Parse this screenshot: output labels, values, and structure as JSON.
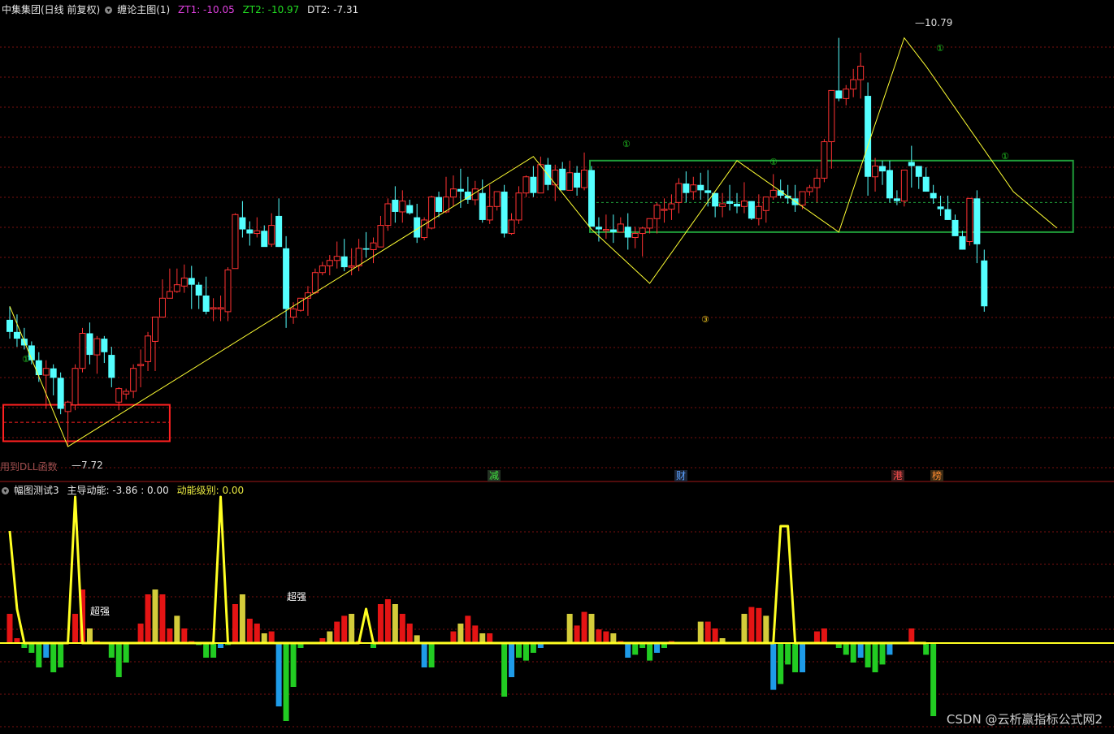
{
  "header": {
    "symbol_label": "中集集团(日线 前复权)",
    "indicator_name": "缠论主图(1)",
    "zt1_label": "ZT1: -10.05",
    "zt2_label": "ZT2: -10.97",
    "dt2_label": "DT2: -7.31"
  },
  "lower_header": {
    "indicator_name": "幅图测试3",
    "main_label": "主导动能: -3.86 : 0.00",
    "level_label": "动能级别: 0.00"
  },
  "annotations": {
    "low_price": "7.72",
    "high_price": "10.79",
    "dll_text": "用到DLL函数",
    "tag_jian": "减",
    "tag_cai": "财",
    "tag_gang": "港",
    "tag_bang": "榜",
    "super_strong_1": "超强",
    "super_strong_2": "超强",
    "pivot_1": "①",
    "pivot_2": "①",
    "pivot_3": "①",
    "pivot_4": "①",
    "pivot_5": "①",
    "pivot_6": "③"
  },
  "watermark": "CSDN @云析赢指标公式网2",
  "colors": {
    "up": "#ff3232",
    "down": "#54ffff",
    "zigzag": "#ffff33",
    "box": "#1f9e3a",
    "grid": "#7a1010",
    "bar_red": "#e41414",
    "bar_yellow": "#d4cc3a",
    "bar_green": "#22cc22",
    "bar_blue": "#1e9be8",
    "line_yellow": "#ffff22"
  },
  "chart_data": [
    {
      "type": "candlestick",
      "y_range": [
        7.6,
        10.85
      ],
      "candles": [
        [
          8.66,
          8.76,
          8.52,
          8.57
        ],
        [
          8.57,
          8.7,
          8.46,
          8.52
        ],
        [
          8.52,
          8.6,
          8.44,
          8.47
        ],
        [
          8.47,
          8.5,
          8.33,
          8.36
        ],
        [
          8.36,
          8.42,
          8.2,
          8.25
        ],
        [
          8.25,
          8.36,
          8.0,
          8.3
        ],
        [
          8.3,
          8.33,
          8.1,
          8.23
        ],
        [
          8.23,
          8.27,
          7.96,
          8.0
        ],
        [
          7.98,
          8.06,
          7.72,
          8.05
        ],
        [
          8.03,
          8.33,
          7.99,
          8.3
        ],
        [
          8.3,
          8.6,
          8.27,
          8.56
        ],
        [
          8.56,
          8.64,
          8.33,
          8.4
        ],
        [
          8.4,
          8.54,
          8.26,
          8.52
        ],
        [
          8.52,
          8.54,
          8.34,
          8.42
        ],
        [
          8.4,
          8.46,
          8.16,
          8.23
        ],
        [
          8.05,
          8.16,
          7.99,
          8.15
        ],
        [
          8.11,
          8.15,
          8.07,
          8.13
        ],
        [
          8.13,
          8.33,
          8.08,
          8.3
        ],
        [
          8.32,
          8.44,
          8.16,
          8.33
        ],
        [
          8.35,
          8.57,
          8.28,
          8.54
        ],
        [
          8.5,
          8.66,
          8.28,
          8.68
        ],
        [
          8.68,
          8.96,
          8.72,
          8.82
        ],
        [
          8.82,
          9.04,
          8.84,
          8.87
        ],
        [
          8.87,
          9.04,
          8.86,
          8.92
        ],
        [
          8.91,
          9.07,
          8.86,
          8.97
        ],
        [
          8.97,
          9.06,
          8.74,
          8.92
        ],
        [
          8.92,
          8.94,
          8.74,
          8.84
        ],
        [
          8.84,
          8.98,
          8.7,
          8.72
        ],
        [
          8.74,
          8.82,
          8.65,
          8.75
        ],
        [
          8.74,
          8.84,
          8.65,
          8.75
        ],
        [
          8.72,
          9.05,
          8.65,
          9.03
        ],
        [
          9.04,
          9.45,
          9.18,
          9.44
        ],
        [
          9.42,
          9.54,
          9.27,
          9.33
        ],
        [
          9.33,
          9.39,
          9.21,
          9.3
        ],
        [
          9.3,
          9.42,
          9.27,
          9.32
        ],
        [
          9.32,
          9.36,
          9.22,
          9.2
        ],
        [
          9.22,
          9.45,
          9.2,
          9.36
        ],
        [
          9.43,
          9.56,
          9.2,
          9.2
        ],
        [
          9.19,
          9.28,
          8.6,
          8.74
        ],
        [
          8.68,
          8.79,
          8.63,
          8.74
        ],
        [
          8.73,
          8.82,
          8.72,
          8.82
        ],
        [
          8.82,
          8.91,
          8.69,
          8.86
        ],
        [
          8.86,
          9.04,
          8.85,
          9.01
        ],
        [
          9.01,
          9.09,
          8.99,
          9.06
        ],
        [
          9.06,
          9.14,
          8.99,
          9.1
        ],
        [
          9.1,
          9.24,
          9.04,
          9.13
        ],
        [
          9.13,
          9.26,
          9.02,
          9.05
        ],
        [
          9.05,
          9.19,
          8.99,
          9.06
        ],
        [
          9.06,
          9.26,
          9.02,
          9.19
        ],
        [
          9.19,
          9.31,
          9.12,
          9.18
        ],
        [
          9.18,
          9.27,
          9.08,
          9.23
        ],
        [
          9.2,
          9.43,
          9.2,
          9.36
        ],
        [
          9.36,
          9.56,
          9.32,
          9.52
        ],
        [
          9.55,
          9.65,
          9.38,
          9.46
        ],
        [
          9.46,
          9.62,
          9.38,
          9.54
        ],
        [
          9.51,
          9.55,
          9.44,
          9.45
        ],
        [
          9.42,
          9.52,
          9.23,
          9.27
        ],
        [
          9.27,
          9.42,
          9.25,
          9.4
        ],
        [
          9.34,
          9.58,
          9.33,
          9.57
        ],
        [
          9.57,
          9.61,
          9.42,
          9.46
        ],
        [
          9.46,
          9.72,
          9.45,
          9.57
        ],
        [
          9.57,
          9.73,
          9.5,
          9.63
        ],
        [
          9.63,
          9.78,
          9.49,
          9.61
        ],
        [
          9.61,
          9.72,
          9.52,
          9.55
        ],
        [
          9.55,
          9.69,
          9.51,
          9.63
        ],
        [
          9.6,
          9.7,
          9.38,
          9.4
        ],
        [
          9.4,
          9.66,
          9.37,
          9.5
        ],
        [
          9.5,
          9.61,
          9.47,
          9.61
        ],
        [
          9.61,
          9.66,
          9.27,
          9.3
        ],
        [
          9.3,
          9.45,
          9.29,
          9.4
        ],
        [
          9.4,
          9.65,
          9.37,
          9.6
        ],
        [
          9.6,
          9.73,
          9.57,
          9.72
        ],
        [
          9.72,
          9.8,
          9.57,
          9.6
        ],
        [
          9.6,
          9.87,
          9.62,
          9.81
        ],
        [
          9.81,
          9.86,
          9.62,
          9.66
        ],
        [
          9.66,
          9.81,
          9.54,
          9.77
        ],
        [
          9.78,
          9.83,
          9.65,
          9.62
        ],
        [
          9.62,
          9.84,
          9.65,
          9.75
        ],
        [
          9.75,
          9.8,
          9.58,
          9.64
        ],
        [
          9.64,
          9.9,
          9.62,
          9.77
        ],
        [
          9.77,
          9.8,
          9.39,
          9.35
        ],
        [
          9.35,
          9.42,
          9.24,
          9.33
        ],
        [
          9.33,
          9.44,
          9.26,
          9.33
        ],
        [
          9.33,
          9.44,
          9.23,
          9.31
        ],
        [
          9.31,
          9.42,
          9.31,
          9.37
        ],
        [
          9.35,
          9.45,
          9.18,
          9.27
        ],
        [
          9.27,
          9.35,
          9.19,
          9.3
        ],
        [
          9.3,
          9.35,
          9.13,
          9.34
        ],
        [
          9.34,
          9.41,
          9.3,
          9.41
        ],
        [
          9.41,
          9.53,
          9.3,
          9.51
        ],
        [
          9.48,
          9.56,
          9.38,
          9.48
        ],
        [
          9.48,
          9.59,
          9.4,
          9.52
        ],
        [
          9.53,
          9.71,
          9.45,
          9.67
        ],
        [
          9.67,
          9.76,
          9.53,
          9.6
        ],
        [
          9.61,
          9.72,
          9.55,
          9.66
        ],
        [
          9.66,
          9.75,
          9.55,
          9.62
        ],
        [
          9.62,
          9.77,
          9.5,
          9.6
        ],
        [
          9.6,
          9.6,
          9.42,
          9.5
        ],
        [
          9.5,
          9.6,
          9.42,
          9.52
        ],
        [
          9.54,
          9.66,
          9.47,
          9.52
        ],
        [
          9.52,
          9.6,
          9.45,
          9.5
        ],
        [
          9.5,
          9.68,
          9.45,
          9.54
        ],
        [
          9.54,
          9.54,
          9.4,
          9.41
        ],
        [
          9.41,
          9.59,
          9.36,
          9.5
        ],
        [
          9.47,
          9.55,
          9.38,
          9.57
        ],
        [
          9.57,
          9.74,
          9.55,
          9.62
        ],
        [
          9.62,
          9.7,
          9.56,
          9.58
        ],
        [
          9.58,
          9.66,
          9.52,
          9.56
        ],
        [
          9.56,
          9.66,
          9.46,
          9.51
        ],
        [
          9.51,
          9.56,
          9.48,
          9.61
        ],
        [
          9.61,
          9.66,
          9.58,
          9.64
        ],
        [
          9.64,
          9.78,
          9.53,
          9.71
        ],
        [
          9.71,
          10.0,
          9.68,
          9.98
        ],
        [
          9.98,
          10.35,
          9.78,
          10.36
        ],
        [
          10.36,
          10.75,
          10.28,
          10.3
        ],
        [
          10.3,
          10.4,
          10.25,
          10.37
        ],
        [
          10.37,
          10.52,
          10.31,
          10.44
        ],
        [
          10.44,
          10.64,
          10.3,
          10.54
        ],
        [
          10.32,
          10.42,
          9.58,
          9.72
        ],
        [
          9.72,
          9.86,
          9.61,
          9.8
        ],
        [
          9.8,
          9.84,
          9.66,
          9.76
        ],
        [
          9.77,
          9.84,
          9.53,
          9.56
        ],
        [
          9.56,
          9.62,
          9.51,
          9.54
        ],
        [
          9.54,
          9.76,
          9.5,
          9.77
        ],
        [
          9.83,
          9.95,
          9.64,
          9.8
        ],
        [
          9.8,
          9.8,
          9.63,
          9.72
        ],
        [
          9.72,
          9.79,
          9.61,
          9.61
        ],
        [
          9.6,
          9.66,
          9.52,
          9.56
        ],
        [
          9.5,
          9.58,
          9.43,
          9.48
        ],
        [
          9.48,
          9.58,
          9.4,
          9.4
        ],
        [
          9.4,
          9.44,
          9.28,
          9.28
        ],
        [
          9.28,
          9.32,
          9.18,
          9.18
        ],
        [
          9.24,
          9.48,
          9.21,
          9.56
        ],
        [
          9.56,
          9.62,
          9.08,
          9.22
        ],
        [
          9.1,
          9.18,
          8.72,
          8.76
        ]
      ],
      "zigzag": [
        [
          0,
          8.76
        ],
        [
          8,
          7.72
        ],
        [
          72,
          9.87
        ],
        [
          80,
          9.33
        ],
        [
          88,
          8.93
        ],
        [
          100,
          9.84
        ],
        [
          114,
          9.31
        ],
        [
          123,
          10.75
        ],
        [
          126,
          10.54
        ],
        [
          138,
          9.61
        ],
        [
          144,
          9.34
        ]
      ],
      "center_box": {
        "from": 80,
        "to": 146,
        "top": 9.84,
        "bottom": 9.31
      },
      "center_mid": 9.53,
      "left_box": {
        "from": 0,
        "to": 22,
        "top": 8.03,
        "bottom": 7.76,
        "mid": 7.9
      }
    },
    {
      "type": "bar",
      "y_range": [
        -0.9,
        1.5
      ],
      "values": [
        0.3,
        0.05,
        -0.05,
        -0.1,
        -0.25,
        -0.15,
        -0.3,
        -0.25,
        0.0,
        0.3,
        0.55,
        0.15,
        0.02,
        0.0,
        -0.15,
        -0.35,
        -0.2,
        0.0,
        0.2,
        0.5,
        0.55,
        0.5,
        0.15,
        0.28,
        0.15,
        0.02,
        -0.02,
        -0.15,
        -0.15,
        -0.05,
        -0.02,
        0.4,
        0.5,
        0.25,
        0.2,
        0.1,
        0.12,
        -0.65,
        -0.8,
        -0.45,
        -0.05,
        0.0,
        0.0,
        0.05,
        0.12,
        0.22,
        0.28,
        0.3,
        0.02,
        0.0,
        -0.05,
        0.4,
        0.45,
        0.4,
        0.3,
        0.2,
        0.08,
        -0.25,
        -0.25,
        0.0,
        0.0,
        0.12,
        0.2,
        0.28,
        0.18,
        0.1,
        0.1,
        0.0,
        -0.55,
        -0.35,
        -0.15,
        -0.18,
        -0.1,
        -0.05,
        0.0,
        0.0,
        0.0,
        0.3,
        0.18,
        0.32,
        0.3,
        0.14,
        0.12,
        0.1,
        0.02,
        -0.15,
        -0.12,
        -0.05,
        -0.18,
        -0.1,
        -0.05,
        0.02,
        0.0,
        0.0,
        0.0,
        0.22,
        0.22,
        0.15,
        0.05,
        0.0,
        0.0,
        0.3,
        0.37,
        0.36,
        0.28,
        -0.48,
        -0.42,
        -0.22,
        -0.3,
        -0.3,
        0.0,
        0.12,
        0.15,
        0.0,
        -0.05,
        -0.12,
        -0.2,
        -0.15,
        -0.25,
        -0.3,
        -0.22,
        -0.12,
        0.0,
        0.0,
        0.15,
        0.0,
        -0.12,
        -0.75
      ],
      "line": [
        1.15,
        0.35,
        0.0,
        0.0,
        0.0,
        0.0,
        0.0,
        0.0,
        0.0,
        1.5,
        0.0,
        0.0,
        0.0,
        0.0,
        0.0,
        0.0,
        0.0,
        0.0,
        0.0,
        0.0,
        0.0,
        0.0,
        0.0,
        0.0,
        0.0,
        0.0,
        0.0,
        0.0,
        0.0,
        1.5,
        0.0,
        0.0,
        0.0,
        0.0,
        0.0,
        0.0,
        0.0,
        0.0,
        0.0,
        0.0,
        0.0,
        0.0,
        0.0,
        0.0,
        0.0,
        0.0,
        0.0,
        0.0,
        0.0,
        0.35,
        0.0,
        0.0,
        0.0,
        0.0,
        0.0,
        0.0,
        0.0,
        0.0,
        0.0,
        0.0,
        0.0,
        0.0,
        0.0,
        0.0,
        0.0,
        0.0,
        0.0,
        0.0,
        0.0,
        0.0,
        0.0,
        0.0,
        0.0,
        0.0,
        0.0,
        0.0,
        0.0,
        0.0,
        0.0,
        0.0,
        0.0,
        0.0,
        0.0,
        0.0,
        0.0,
        0.0,
        0.0,
        0.0,
        0.0,
        0.0,
        0.0,
        0.0,
        0.0,
        0.0,
        0.0,
        0.0,
        0.0,
        0.0,
        0.0,
        0.0,
        0.0,
        0.0,
        0.0,
        0.0,
        0.0,
        0.0,
        1.2,
        1.2,
        0.0,
        0.0,
        0.0,
        0.0,
        0.0,
        0.0,
        0.0,
        0.0,
        0.0,
        0.0,
        0.0,
        0.0,
        0.0,
        0.0,
        0.0,
        0.0,
        0.0,
        0.0,
        0.0
      ]
    }
  ]
}
